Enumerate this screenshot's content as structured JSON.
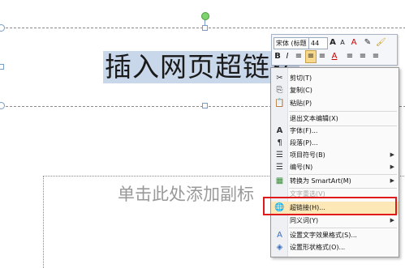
{
  "slide": {
    "title": "插入网页超链接",
    "subtitle_placeholder": "单击此处添加副标"
  },
  "mini_toolbar": {
    "font_name": "宋体 (标题",
    "font_size": "44",
    "buttons": [
      "A",
      "A",
      "A",
      "B",
      "I",
      "≡",
      "≡",
      "≡",
      "A",
      "≡",
      "≡",
      "≡"
    ]
  },
  "context_menu": {
    "items": [
      {
        "icon": "cut-icon",
        "glyph": "✂",
        "label": "剪切(T)",
        "enabled": true,
        "submenu": false
      },
      {
        "icon": "copy-icon",
        "glyph": "⎘",
        "label": "复制(C)",
        "enabled": true,
        "submenu": false
      },
      {
        "icon": "paste-icon",
        "glyph": "📋",
        "label": "粘贴(P)",
        "enabled": true,
        "submenu": false
      },
      {
        "icon": "",
        "glyph": "",
        "label": "退出文本编辑(X)",
        "enabled": true,
        "submenu": false
      },
      {
        "icon": "font-icon",
        "glyph": "A",
        "label": "字体(F)...",
        "enabled": true,
        "submenu": false
      },
      {
        "icon": "paragraph-icon",
        "glyph": "¶",
        "label": "段落(P)...",
        "enabled": true,
        "submenu": false
      },
      {
        "icon": "bullets-icon",
        "glyph": "☰",
        "label": "项目符号(B)",
        "enabled": true,
        "submenu": true
      },
      {
        "icon": "numbering-icon",
        "glyph": "☰",
        "label": "编号(N)",
        "enabled": true,
        "submenu": true
      },
      {
        "icon": "smartart-icon",
        "glyph": "▦",
        "label": "转换为 SmartArt(M)",
        "enabled": true,
        "submenu": true
      },
      {
        "icon": "",
        "glyph": "",
        "label": "文字重选(V)",
        "enabled": false,
        "submenu": false
      },
      {
        "icon": "hyperlink-icon",
        "glyph": "🌐",
        "label": "超链接(H)...",
        "enabled": true,
        "submenu": false
      },
      {
        "icon": "",
        "glyph": "",
        "label": "同义词(Y)",
        "enabled": true,
        "submenu": true
      },
      {
        "icon": "text-effects-icon",
        "glyph": "A",
        "label": "设置文字效果格式(S)...",
        "enabled": true,
        "submenu": false
      },
      {
        "icon": "shape-format-icon",
        "glyph": "◈",
        "label": "设置形状格式(O)...",
        "enabled": true,
        "submenu": false
      }
    ]
  }
}
